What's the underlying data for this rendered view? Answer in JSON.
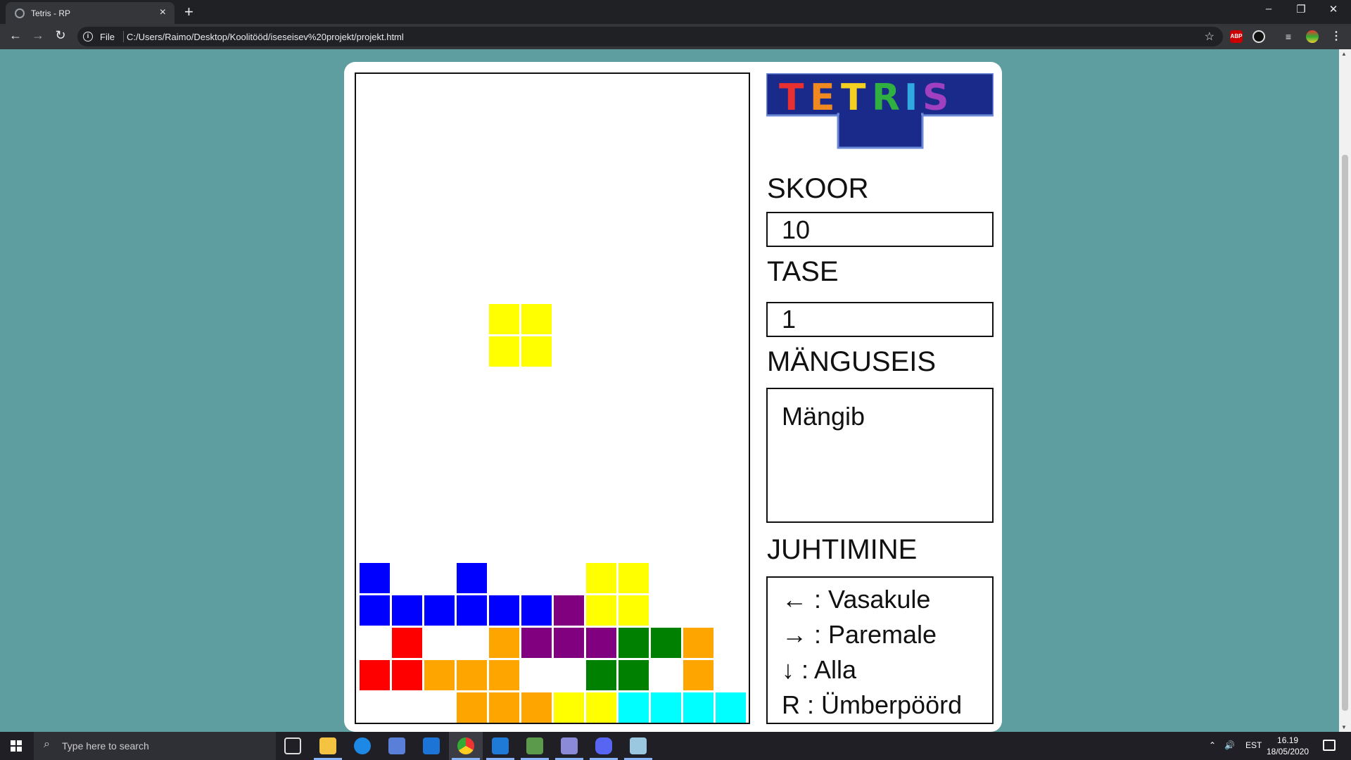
{
  "browser": {
    "tab_title": "Tetris - RP",
    "tab_close": "×",
    "new_tab": "+",
    "file_label": "File",
    "url": "C:/Users/Raimo/Desktop/Koolitööd/iseseisev%20projekt/projekt.html",
    "minimize": "–",
    "restore": "❐",
    "close": "✕",
    "back": "←",
    "forward": "→",
    "reload": "↻",
    "star": "☆",
    "ext_abp": "ABP"
  },
  "game": {
    "logo_text": "TETRIS",
    "score_label": "SKOOR",
    "score_value": "10",
    "level_label": "TASE",
    "level_value": "1",
    "state_label": "MÄNGUSEIS",
    "state_value": "Mängib",
    "controls_label": "JUHTIMINE",
    "controls": [
      "← : Vasakule",
      "→ : Paremale",
      "↓ : Alla",
      "R : Ümberpöörd"
    ],
    "colors": {
      "blue": "#0000ff",
      "purple": "#800080",
      "yellow": "#ffff00",
      "orange": "#ffa500",
      "red": "#ff0000",
      "green": "#008000",
      "cyan": "#00ffff"
    },
    "grid_columns": 12,
    "grid_rows": 20,
    "active_piece": {
      "color": "yellow",
      "cells": [
        [
          4,
          7
        ],
        [
          5,
          7
        ],
        [
          4,
          8
        ],
        [
          5,
          8
        ]
      ]
    },
    "stack": [
      {
        "col": 0,
        "row": 15,
        "color": "blue"
      },
      {
        "col": 3,
        "row": 15,
        "color": "blue"
      },
      {
        "col": 7,
        "row": 15,
        "color": "yellow"
      },
      {
        "col": 8,
        "row": 15,
        "color": "yellow"
      },
      {
        "col": 0,
        "row": 16,
        "color": "blue"
      },
      {
        "col": 1,
        "row": 16,
        "color": "blue"
      },
      {
        "col": 2,
        "row": 16,
        "color": "blue"
      },
      {
        "col": 3,
        "row": 16,
        "color": "blue"
      },
      {
        "col": 4,
        "row": 16,
        "color": "blue"
      },
      {
        "col": 5,
        "row": 16,
        "color": "blue"
      },
      {
        "col": 6,
        "row": 16,
        "color": "purple"
      },
      {
        "col": 7,
        "row": 16,
        "color": "yellow"
      },
      {
        "col": 8,
        "row": 16,
        "color": "yellow"
      },
      {
        "col": 1,
        "row": 17,
        "color": "red"
      },
      {
        "col": 4,
        "row": 17,
        "color": "orange"
      },
      {
        "col": 5,
        "row": 17,
        "color": "purple"
      },
      {
        "col": 6,
        "row": 17,
        "color": "purple"
      },
      {
        "col": 7,
        "row": 17,
        "color": "purple"
      },
      {
        "col": 8,
        "row": 17,
        "color": "green"
      },
      {
        "col": 9,
        "row": 17,
        "color": "green"
      },
      {
        "col": 10,
        "row": 17,
        "color": "orange"
      },
      {
        "col": 0,
        "row": 18,
        "color": "red"
      },
      {
        "col": 1,
        "row": 18,
        "color": "red"
      },
      {
        "col": 2,
        "row": 18,
        "color": "orange"
      },
      {
        "col": 3,
        "row": 18,
        "color": "orange"
      },
      {
        "col": 4,
        "row": 18,
        "color": "orange"
      },
      {
        "col": 7,
        "row": 18,
        "color": "green"
      },
      {
        "col": 8,
        "row": 18,
        "color": "green"
      },
      {
        "col": 10,
        "row": 18,
        "color": "orange"
      },
      {
        "col": 3,
        "row": 19,
        "color": "orange"
      },
      {
        "col": 4,
        "row": 19,
        "color": "orange"
      },
      {
        "col": 5,
        "row": 19,
        "color": "orange"
      },
      {
        "col": 6,
        "row": 19,
        "color": "yellow"
      },
      {
        "col": 7,
        "row": 19,
        "color": "yellow"
      },
      {
        "col": 8,
        "row": 19,
        "color": "cyan"
      },
      {
        "col": 9,
        "row": 19,
        "color": "cyan"
      },
      {
        "col": 10,
        "row": 19,
        "color": "cyan"
      },
      {
        "col": 11,
        "row": 19,
        "color": "cyan"
      }
    ]
  },
  "taskbar": {
    "search_placeholder": "Type here to search",
    "language": "EST",
    "time": "16.19",
    "date": "18/05/2020"
  }
}
